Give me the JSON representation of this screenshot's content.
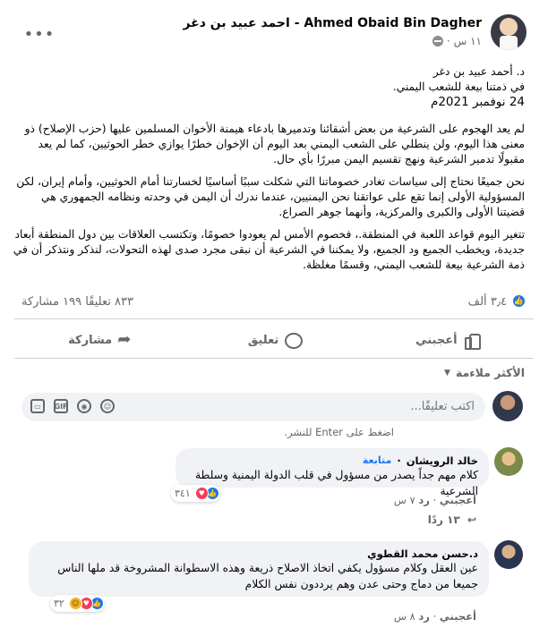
{
  "post": {
    "author_name": "Ahmed Obaid Bin Dagher - احمد عبيد بن دغر",
    "time": "١١ س",
    "visibility_icon": "globe-icon",
    "more_icon": "more-icon",
    "signature": {
      "line1": "د. أحمد عبيد بن دغر",
      "line2": "في ذمتنا بيعة للشعب اليمني.",
      "date": "24 نوفمبر 2021م"
    },
    "paragraphs": [
      "لم يعد الهجوم على الشرعية من بعض أشقائنا وتدميرها بادعاء هيمنة الأخوان المسلمين عليها (حزب الإصلاح) ذو معنى هذا اليوم، ولن ينطلي على الشعب اليمني بعد اليوم أن الإخوان خطرًا يوازي خطر الحوثيين، كما لم يعد مقبولًا تدمير الشرعية ونهج تقسيم اليمن مبررًا بأي حال.",
      "نحن جميعًا نحتاج إلى سياسات تغادر خصوماتنا التي شكلت سببًا أساسيًا لخسارتنا أمام الحوثيين، وأمام إيران، لكن المسؤولية الأولى إنما تقع على عواتقنا نحن اليمنيين، عندما ندرك أن اليمن في وحدته ونظامه الجمهوري هي قضيتنا الأولى والكبرى والمركزية، وأنهما جوهر الصراع.",
      "تتغير اليوم قواعد اللعبة في المنطقة.، فخصوم الأمس لم يعودوا خصومًا، وتكتسب العلاقات بين دول المنطقة أبعاد جديدة، ويخطب الجميع ود الجميع، ولا يمكننا في الشرعية أن نبقى مجرد صدى لهذه التحولات، لنذكر ونتذكر أن في ذمة الشرعية بيعة للشعب اليمني، وقسمًا مغلظة."
    ],
    "reactions_count": "٣٫٤ ألف",
    "comments_count": "٨٣٣ تعليقًا",
    "shares_count": "١٩٩ مشاركة"
  },
  "actions": {
    "like_label": "أعجبني",
    "comment_label": "تعليق",
    "share_label": "مشاركة"
  },
  "sort": {
    "label": "الأكثر ملاءمة"
  },
  "composer": {
    "placeholder": "اكتب تعليقًا...",
    "hint": "اضغط على Enter للنشر."
  },
  "comments": [
    {
      "author": "خالد الرويشان",
      "follow": "متابعة",
      "text": "كلام مهم جداً يصدر من مسؤول في قلب الدولة اليمنية وسلطة الشرعية",
      "reactions": "٣٤١",
      "like": "أعجبني",
      "reply": "رد",
      "time": "٧ س",
      "replies": "١٣ ردًا"
    },
    {
      "author": "د.حسن محمد القطوي",
      "text_line1": "عين العقل وكلام مسؤول يكفي اتخاذ الاصلاح ذريعة وهذه الاسطوانة المشروخة قد ملها الناس",
      "text_line2": "جميعا من دماج وحتى عدن وهم يرددون نفس الكلام",
      "reactions": "٣٢",
      "like": "أعجبني",
      "reply": "رد",
      "time": "٨ س"
    }
  ],
  "colors": {
    "accent": "#1877f2",
    "secondary_text": "#65676b",
    "bubble": "#f0f2f5",
    "love": "#f33e58",
    "haha": "#f7b125"
  }
}
